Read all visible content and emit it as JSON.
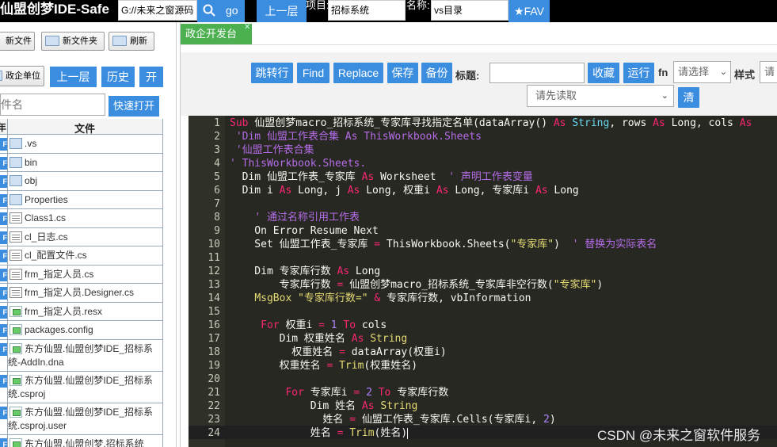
{
  "app": {
    "title": "仙盟创梦IDE-Safe",
    "path_value": "G://未来之窗源码",
    "go_label": "go",
    "up_label": "上一层",
    "project_label": "项目:",
    "project_value": "招标系统",
    "name_label": "名称:",
    "name_value": "vs目录",
    "fav_label": "★FAV"
  },
  "left": {
    "new_file": "新文件",
    "new_folder": "新文件夹",
    "refresh": "刷新",
    "company_unit": "政企单位",
    "up": "上一层",
    "history": "历史",
    "open": "开",
    "file_name_placeholder": "件名",
    "quick_open": "快速打开",
    "col_first": "年",
    "col_file": "文件",
    "strip_letter": "F",
    "files": [
      {
        "name": ".vs",
        "icon": "folder-icon"
      },
      {
        "name": "bin",
        "icon": "folder-icon"
      },
      {
        "name": "obj",
        "icon": "folder-icon"
      },
      {
        "name": "Properties",
        "icon": "folder-icon"
      },
      {
        "name": "Class1.cs",
        "icon": "document-icon"
      },
      {
        "name": "cl_日志.cs",
        "icon": "document-icon"
      },
      {
        "name": "cl_配置文件.cs",
        "icon": "document-icon"
      },
      {
        "name": "frm_指定人员.cs",
        "icon": "document-icon"
      },
      {
        "name": "frm_指定人员.Designer.cs",
        "icon": "document-icon"
      },
      {
        "name": "frm_指定人员.resx",
        "icon": "image-icon"
      },
      {
        "name": "packages.config",
        "icon": "image-icon"
      },
      {
        "name": "东方仙盟.仙盟创梦IDE_招标系",
        "name2": "统-AddIn.dna",
        "icon": "image-icon"
      },
      {
        "name": "东方仙盟.仙盟创梦IDE_招标系",
        "name2": "统.csproj",
        "icon": "image-icon"
      },
      {
        "name": "东方仙盟.仙盟创梦IDE_招标系",
        "name2": "统.csproj.user",
        "icon": "image-icon"
      },
      {
        "name": "东方仙盟.仙盟创梦.招标系统",
        "icon": "image-icon"
      }
    ]
  },
  "tabs": [
    {
      "label": "政企开发台",
      "close": "✕"
    }
  ],
  "toolbar": {
    "goto": "跳转行",
    "find": "Find",
    "replace": "Replace",
    "save": "保存",
    "backup": "备份",
    "title_label": "标题:",
    "title_value": "",
    "favorite": "收藏",
    "run": "运行",
    "fn_label": "fn",
    "fn_select": "请选择",
    "style_label": "样式",
    "style_input": "请",
    "read_select": "请先读取",
    "clear": "清"
  },
  "editor": {
    "lines": [
      "1",
      "2",
      "3",
      "4",
      "5",
      "6",
      "7",
      "8",
      "9",
      "10",
      "11",
      "12",
      "13",
      "14",
      "15",
      "16",
      "17",
      "18",
      "19",
      "20",
      "21",
      "22",
      "23",
      "24"
    ]
  },
  "watermark": "CSDN @未来之窗软件服务",
  "colors": {
    "accent_blue": "#3b8de0",
    "tab_green": "#4caf50",
    "editor_bg": "#272822",
    "keyword": "#f92672",
    "type": "#66d9ef",
    "string": "#e6db74",
    "comment": "#b56ce8"
  }
}
